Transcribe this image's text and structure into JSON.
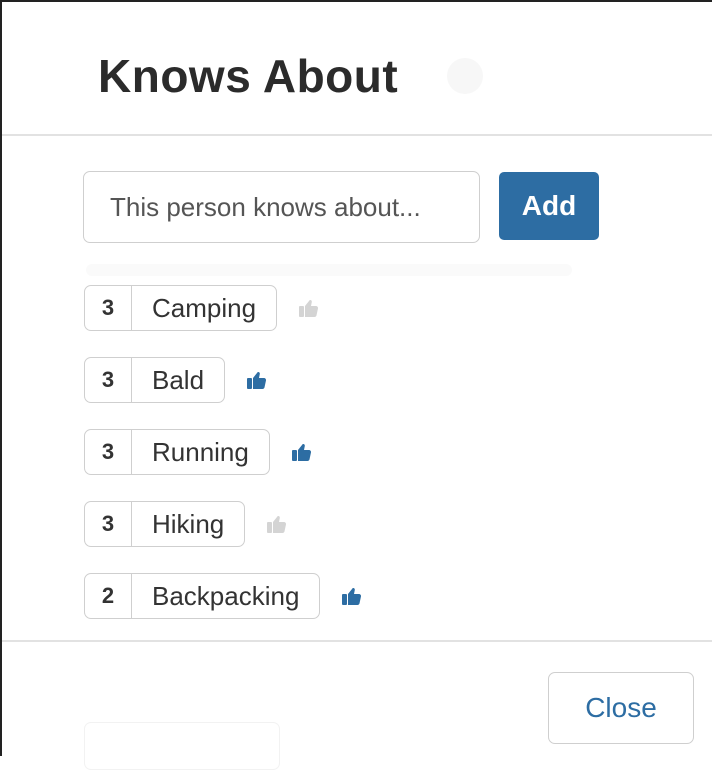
{
  "modal": {
    "title": "Knows About"
  },
  "input": {
    "placeholder": "This person knows about..."
  },
  "add_button": {
    "label": "Add"
  },
  "tags": [
    {
      "count": "3",
      "name": "Camping",
      "liked": false
    },
    {
      "count": "3",
      "name": "Bald",
      "liked": true
    },
    {
      "count": "3",
      "name": "Running",
      "liked": true
    },
    {
      "count": "3",
      "name": "Hiking",
      "liked": false
    },
    {
      "count": "2",
      "name": "Backpacking",
      "liked": true
    }
  ],
  "close_button": {
    "label": "Close"
  },
  "colors": {
    "accent": "#2d6da3",
    "thumb_inactive": "#d4d4d4"
  },
  "icons": {
    "like": "thumbs-up-icon"
  }
}
